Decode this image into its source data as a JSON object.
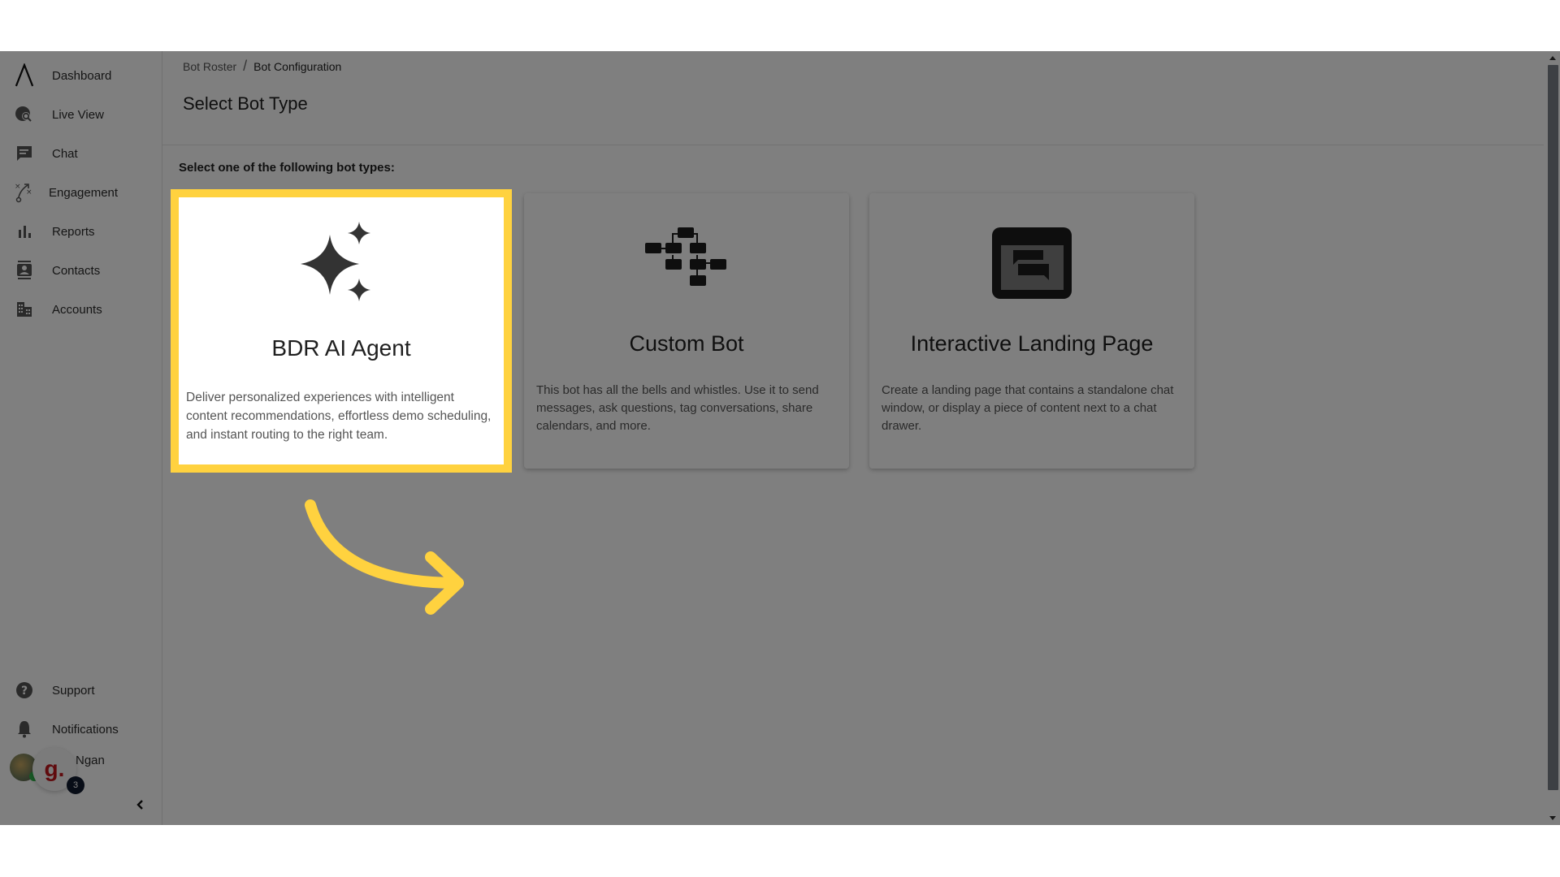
{
  "sidebar": {
    "items": [
      {
        "label": "Dashboard",
        "icon": "logo-caret-icon"
      },
      {
        "label": "Live View",
        "icon": "globe-search-icon"
      },
      {
        "label": "Chat",
        "icon": "chat-bubble-icon"
      },
      {
        "label": "Engagement",
        "icon": "strategy-play-icon"
      },
      {
        "label": "Reports",
        "icon": "bar-chart-icon"
      },
      {
        "label": "Contacts",
        "icon": "contact-card-icon"
      },
      {
        "label": "Accounts",
        "icon": "building-icon"
      }
    ],
    "bottom": [
      {
        "label": "Support",
        "icon": "help-circle-icon"
      },
      {
        "label": "Notifications",
        "icon": "bell-icon"
      }
    ],
    "user": {
      "name": "Ngan",
      "brand_letter": "g.",
      "badge_count": "3"
    },
    "collapse_icon": "chevron-left-icon"
  },
  "breadcrumb": {
    "items": [
      "Bot Roster",
      "Bot Configuration"
    ],
    "separator": "/"
  },
  "page": {
    "title": "Select Bot Type",
    "subtitle": "Select one of the following bot types:"
  },
  "cards": [
    {
      "title": "BDR AI Agent",
      "icon": "sparkles-icon",
      "description": "Deliver personalized experiences with intelligent content recommendations, effortless demo scheduling, and instant routing to the right team.",
      "highlighted": true
    },
    {
      "title": "Custom Bot",
      "icon": "flowchart-icon",
      "description": "This bot has all the bells and whistles. Use it to send messages, ask questions, tag conversations, share calendars, and more.",
      "highlighted": false
    },
    {
      "title": "Interactive Landing Page",
      "icon": "landing-page-chat-icon",
      "description": "Create a landing page that contains a standalone chat window, or display a piece of content next to a chat drawer.",
      "highlighted": false
    }
  ],
  "colors": {
    "highlight": "#ffd23f",
    "overlay": "rgba(0,0,0,0.5)",
    "brand_red": "#c0161c",
    "badge": "#111a2e"
  }
}
